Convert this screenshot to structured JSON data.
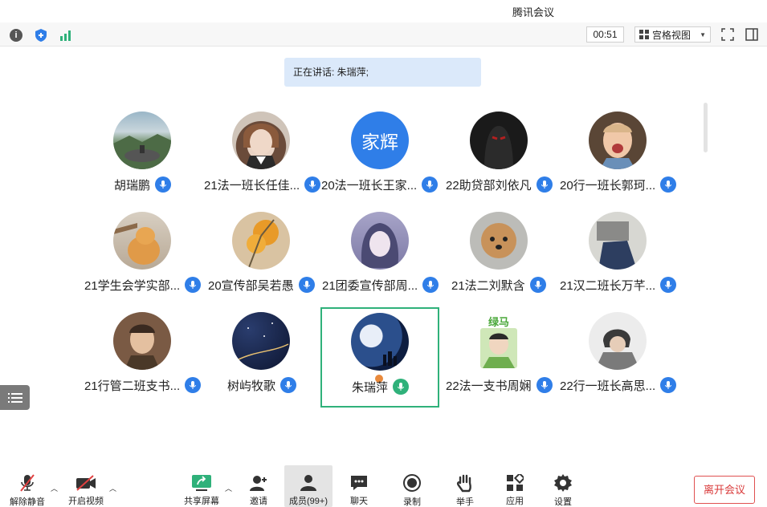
{
  "window": {
    "title": "腾讯会议"
  },
  "toolbar": {
    "timer": "00:51",
    "view_label": "宫格视图",
    "icons": [
      "info-icon",
      "shield-icon",
      "signal-icon",
      "fullscreen-icon",
      "side-panel-icon"
    ]
  },
  "speaking": {
    "text": "正在讲话: 朱瑞萍;"
  },
  "participants": [
    {
      "name": "胡瑞鹏",
      "mic": "muted"
    },
    {
      "name": "21法一班长任佳...",
      "mic": "muted"
    },
    {
      "name": "20法一班长王家...",
      "mic": "muted",
      "avatar_text": "家辉"
    },
    {
      "name": "22助贷部刘依凡",
      "mic": "muted"
    },
    {
      "name": "20行一班长郭珂...",
      "mic": "muted"
    },
    {
      "name": "21学生会学实部...",
      "mic": "muted"
    },
    {
      "name": "20宣传部吴若愚",
      "mic": "muted"
    },
    {
      "name": "21团委宣传部周...",
      "mic": "muted"
    },
    {
      "name": "21法二刘默含",
      "mic": "muted"
    },
    {
      "name": "21汉二班长万芊...",
      "mic": "muted"
    },
    {
      "name": "21行管二班支书...",
      "mic": "muted"
    },
    {
      "name": "树屿牧歌",
      "mic": "muted"
    },
    {
      "name": "朱瑞萍",
      "mic": "speaking",
      "active": true
    },
    {
      "name": "22法一支书周娴",
      "mic": "muted",
      "avatar_text": "绿马"
    },
    {
      "name": "22行一班长高思...",
      "mic": "muted"
    }
  ],
  "bottombar": {
    "unmute": "解除静音",
    "start_video": "开启视频",
    "share_screen": "共享屏幕",
    "invite": "邀请",
    "members": "成员(99+)",
    "chat": "聊天",
    "record": "录制",
    "raise_hand": "举手",
    "apps": "应用",
    "settings": "设置",
    "leave": "离开会议"
  },
  "colors": {
    "accent_blue": "#2f7ee8",
    "active_green": "#2fb17a",
    "leave_red": "#d93a3a",
    "speaking_bg": "#dbe9fa"
  }
}
